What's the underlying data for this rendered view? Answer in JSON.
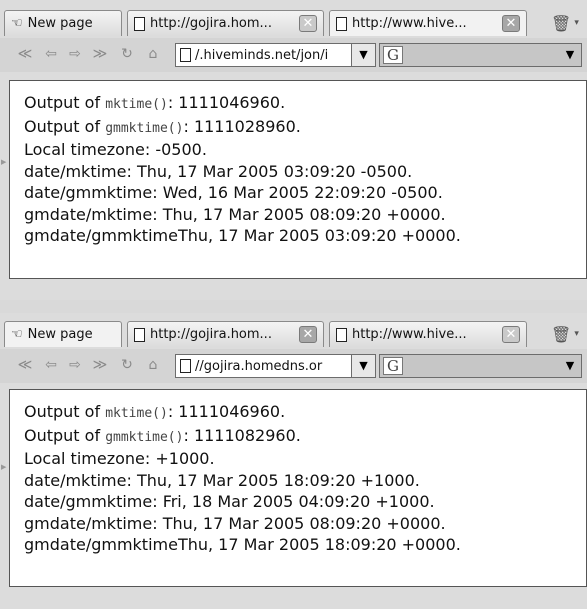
{
  "windows": [
    {
      "tabs": [
        {
          "label": "New page"
        },
        {
          "label": "http://gojira.hom..."
        },
        {
          "label": "http://www.hive..."
        }
      ],
      "url": "/.hiveminds.net/jon/i",
      "search_engine_icon": "G",
      "output": {
        "mktime_prefix": "Output of",
        "mktime_fn": "mktime()",
        "mktime_value": ": 1111046960.",
        "gmmktime_prefix": "Output of",
        "gmmktime_fn": "gmmktime()",
        "gmmktime_value": ": 1111028960.",
        "lines": [
          "Local timezone: -0500.",
          "date/mktime: Thu, 17 Mar 2005 03:09:20 -0500.",
          "date/gmmktime: Wed, 16 Mar 2005 22:09:20 -0500.",
          "gmdate/mktime: Thu, 17 Mar 2005 08:09:20 +0000.",
          "gmdate/gmmktimeThu, 17 Mar 2005 03:09:20 +0000."
        ]
      }
    },
    {
      "tabs": [
        {
          "label": "New page"
        },
        {
          "label": "http://gojira.hom..."
        },
        {
          "label": "http://www.hive..."
        }
      ],
      "url": "//gojira.homedns.or",
      "search_engine_icon": "G",
      "output": {
        "mktime_prefix": "Output of",
        "mktime_fn": "mktime()",
        "mktime_value": ": 1111046960.",
        "gmmktime_prefix": "Output of",
        "gmmktime_fn": "gmmktime()",
        "gmmktime_value": ": 1111082960.",
        "lines": [
          "Local timezone: +1000.",
          "date/mktime: Thu, 17 Mar 2005 18:09:20 +1000.",
          "date/gmmktime: Fri, 18 Mar 2005 04:09:20 +1000.",
          "gmdate/mktime: Thu, 17 Mar 2005 08:09:20 +0000.",
          "gmdate/gmmktimeThu, 17 Mar 2005 18:09:20 +0000."
        ]
      }
    }
  ],
  "icons": {
    "new_page": "cursor-hand-icon",
    "back": "rewind-icon",
    "prev": "back-arrow-icon",
    "next": "forward-arrow-icon",
    "fast_forward": "fast-forward-icon",
    "reload": "reload-icon",
    "home": "home-icon",
    "close_tab": "close-icon",
    "trash": "trash-icon"
  },
  "colors": {
    "chrome": "#dcdcdc",
    "content_bg": "#ffffff",
    "close_button": "#a7a7a7"
  }
}
